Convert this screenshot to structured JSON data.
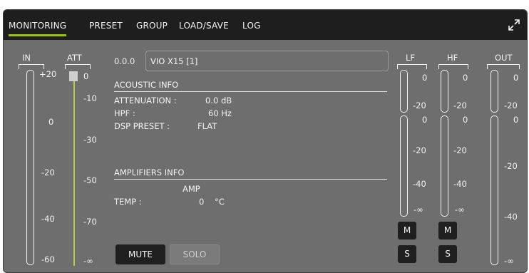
{
  "tabs": [
    "MONITORING",
    "PRESET",
    "GROUP",
    "LOAD/SAVE",
    "LOG"
  ],
  "active_tab": "MONITORING",
  "device": {
    "address": "0.0.0",
    "name": "VIO X15 [1]"
  },
  "meters": {
    "in": {
      "label": "IN",
      "ticks": [
        "+20",
        "0",
        "-20",
        "-40",
        "-60"
      ]
    },
    "att": {
      "label": "ATT",
      "ticks": [
        "0",
        "-10",
        "-30",
        "-50",
        "-70",
        "-∞"
      ]
    },
    "lf": {
      "label": "LF",
      "top_ticks": [
        "0",
        "-20"
      ],
      "bottom_ticks": [
        "0",
        "-20",
        "-40",
        "-∞"
      ]
    },
    "hf": {
      "label": "HF",
      "top_ticks": [
        "0",
        "-20"
      ],
      "bottom_ticks": [
        "0",
        "-20",
        "-40",
        "-∞"
      ]
    },
    "out": {
      "label": "OUT",
      "ticks": [
        "0",
        "-20",
        "0",
        "-20",
        "-40",
        "-∞"
      ]
    }
  },
  "acoustic": {
    "title": "ACOUSTIC INFO",
    "attenuation_label": "ATTENUATION :",
    "attenuation_value": "0.0 dB",
    "hpf_label": "HPF :",
    "hpf_value": "60 Hz",
    "dsp_label": "DSP PRESET :",
    "dsp_value": "FLAT"
  },
  "amplifiers": {
    "title": "AMPLIFIERS INFO",
    "column": "AMP",
    "temp_label": "TEMP :",
    "temp_value": "0",
    "temp_unit": "°C"
  },
  "buttons": {
    "mute": "MUTE",
    "solo": "SOLO",
    "m": "M",
    "s": "S"
  },
  "colors": {
    "accent": "#9bbf1f",
    "panel": "#6e6e6e",
    "tabbar": "#1e1e1e"
  }
}
